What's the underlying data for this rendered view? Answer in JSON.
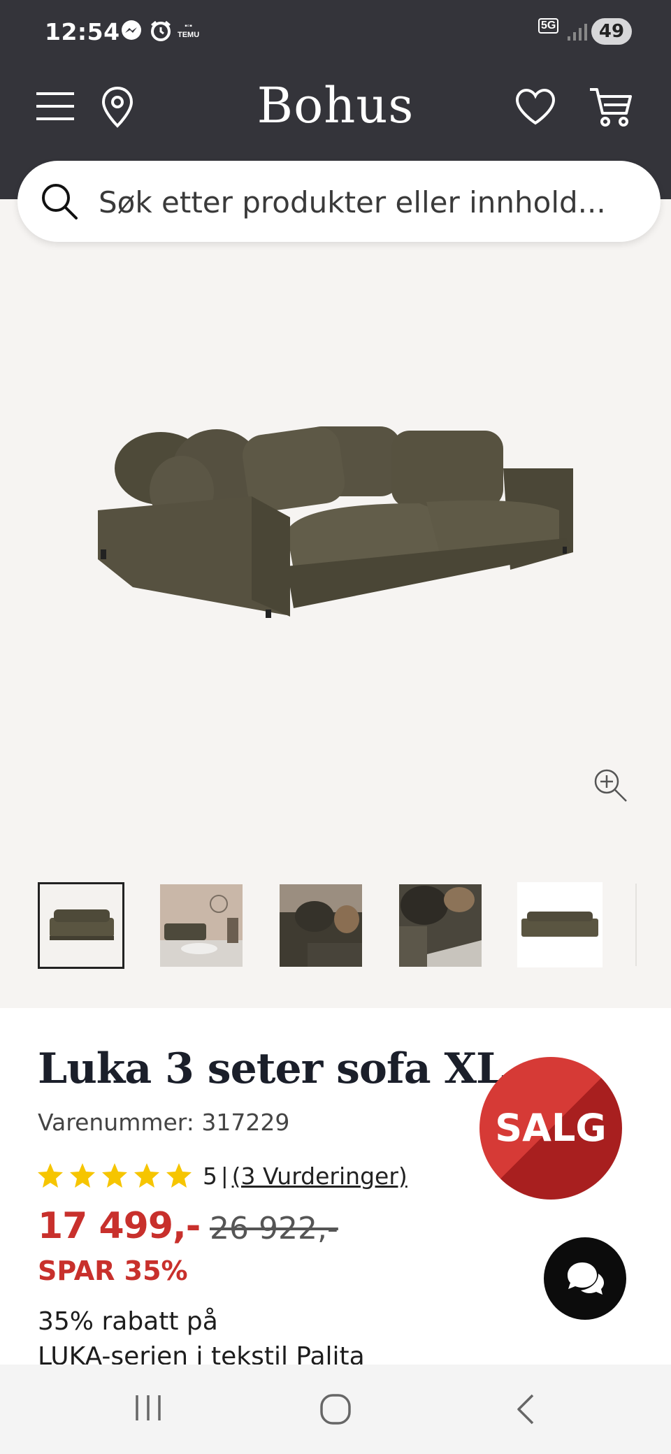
{
  "status_bar": {
    "time": "12:54",
    "temu_label": "TEMU",
    "network": "5G",
    "battery": "49"
  },
  "header": {
    "logo": "Bohus",
    "icons": [
      "menu-icon",
      "location-pin-icon",
      "heart-icon",
      "cart-icon"
    ]
  },
  "search": {
    "placeholder": "Søk etter produkter eller innhold..."
  },
  "gallery": {
    "thumbnail_count": 5,
    "selected_index": 0
  },
  "product": {
    "title": "Luka 3 seter sofa XL",
    "sku": "Varenummer: 317229",
    "rating_value": 5,
    "rating_score_label": "5",
    "rating_separator": "|",
    "rating_link": "(3 Vurderinger)",
    "price": "17 499,-",
    "old_price": "26 922,-",
    "save": "SPAR 35%",
    "promo_line1": "35% rabatt på",
    "promo_line2": "LUKA-serien i tekstil Palita",
    "badge": "SALG"
  },
  "colors": {
    "header_bg": "#34343a",
    "sale_red": "#c8302c",
    "star_yellow": "#f6c500",
    "sofa_olive": "#5a5541"
  },
  "navbar": {
    "buttons": [
      "recent-apps-icon",
      "home-icon",
      "back-icon"
    ]
  }
}
